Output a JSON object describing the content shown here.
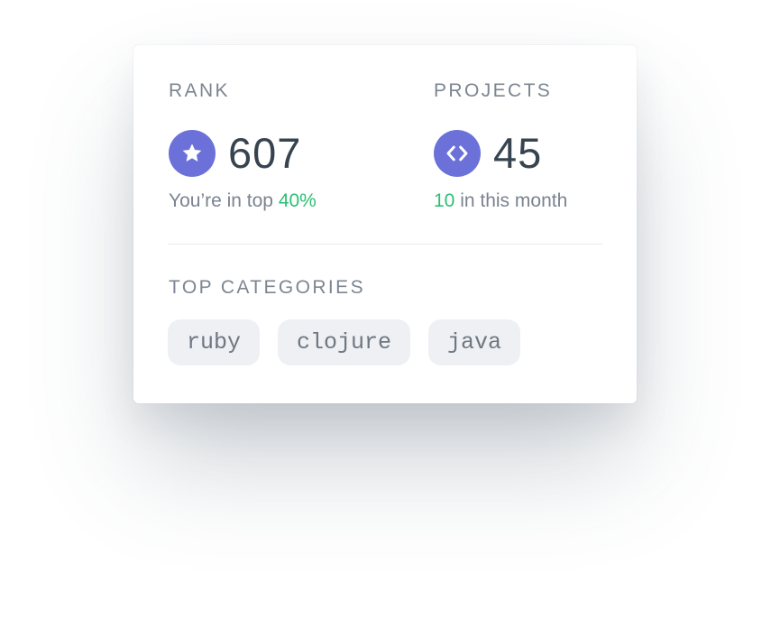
{
  "rank": {
    "label": "RANK",
    "value": "607",
    "sub_prefix": "You’re in top",
    "sub_highlight": "40%",
    "icon": "star-icon"
  },
  "projects": {
    "label": "PROJECTS",
    "value": "45",
    "sub_highlight": "10",
    "sub_suffix": "in this month",
    "icon": "code-icon"
  },
  "categories": {
    "label": "TOP CATEGORIES",
    "items": [
      "ruby",
      "clojure",
      "java"
    ]
  },
  "colors": {
    "accent_purple": "#6b71d8",
    "accent_green": "#2bbf72",
    "text_dark": "#374450",
    "text_muted": "#7c8591",
    "tag_bg": "#eef0f3"
  }
}
